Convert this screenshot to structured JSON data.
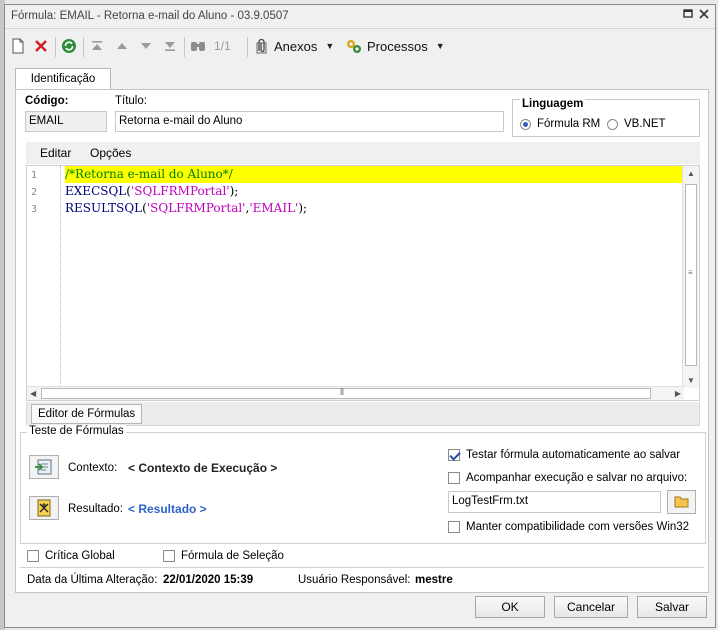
{
  "window": {
    "title": "Fórmula: EMAIL - Retorna e-mail do Aluno - 03.9.0507",
    "restore_icon": "maximize-icon",
    "close_icon": "close-icon"
  },
  "toolbar": {
    "record_counter": "1/1",
    "annexes_label": "Anexos",
    "processes_label": "Processos",
    "icons": [
      "new-document-icon",
      "delete-icon",
      "refresh-icon",
      "first-record-icon",
      "previous-record-icon",
      "next-record-icon",
      "last-record-icon",
      "search-icon",
      "attachment-icon",
      "processes-icon"
    ]
  },
  "tabs": {
    "identification": "Identificação"
  },
  "identification": {
    "code_label": "Código:",
    "code_value": "EMAIL",
    "title_label": "Título:",
    "title_value": "Retorna e-mail do Aluno",
    "language_label": "Linguagem",
    "language_options": [
      "Fórmula RM",
      "VB.NET"
    ],
    "language_selected": "Fórmula RM"
  },
  "editor": {
    "menu": [
      "Editar",
      "Opções"
    ],
    "line_numbers": [
      "1",
      "2",
      "3"
    ],
    "lines": {
      "l1": "/*Retorna e-mail do Aluno*/",
      "l2_fn": "EXECSQL",
      "l2_open": "(",
      "l2_str": "'SQLFRMPortal'",
      "l2_close": ");",
      "l3_fn": "RESULTSQL",
      "l3_open": "(",
      "l3_str1": "'SQLFRMPortal'",
      "l3_comma": ",",
      "l3_str2": "'EMAIL'",
      "l3_close": ");"
    },
    "colors": {
      "highlight": "#ffff00",
      "comment": "#008000",
      "string": "#c000c0",
      "keyword": "#000080"
    },
    "bottom_tab": "Editor de Fórmulas"
  },
  "test": {
    "legend": "Teste de Fórmulas",
    "context_label": "Contexto:",
    "context_value": "< Contexto de Execução >",
    "result_label": "Resultado:",
    "result_value": "< Resultado >",
    "auto_test_label": "Testar fórmula automaticamente ao salvar",
    "auto_test_checked": true,
    "follow_label": "Acompanhar execução e salvar no arquivo:",
    "follow_checked": false,
    "log_file": "LogTestFrm.txt",
    "compat_label": "Manter compatibilidade com versões Win32",
    "compat_checked": false
  },
  "flags": {
    "critical_global": "Crítica Global",
    "selection_formula": "Fórmula de Seleção"
  },
  "footer": {
    "last_change_label": "Data da Última Alteração:",
    "last_change_value": "22/01/2020 15:39",
    "user_label": "Usuário Responsável:",
    "user_value": "mestre"
  },
  "buttons": {
    "ok": "OK",
    "cancel": "Cancelar",
    "save": "Salvar"
  }
}
